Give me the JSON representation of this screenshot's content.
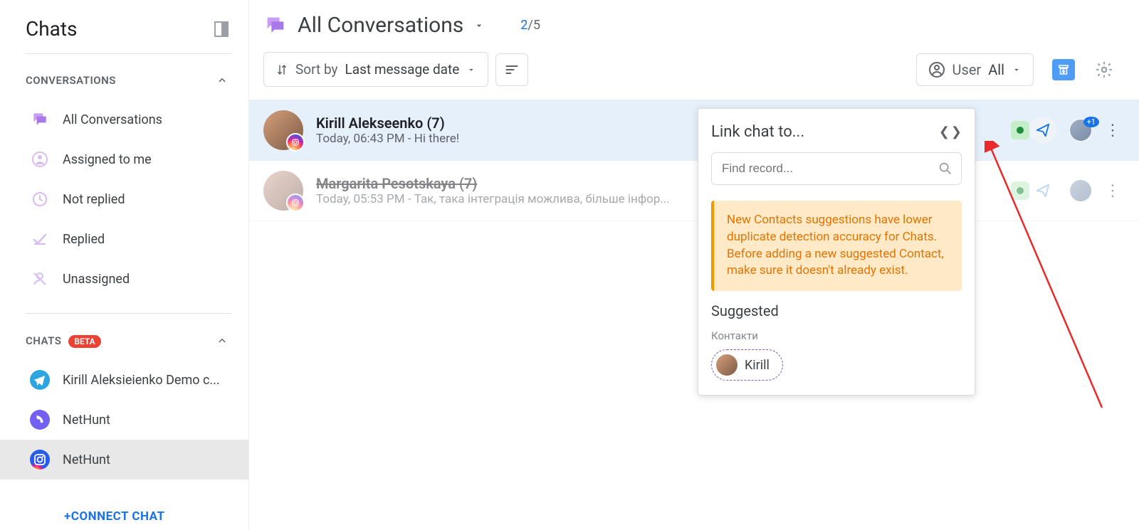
{
  "sidebar": {
    "title": "Chats",
    "sections": {
      "conversations": {
        "label": "CONVERSATIONS",
        "items": [
          {
            "label": "All Conversations"
          },
          {
            "label": "Assigned to me"
          },
          {
            "label": "Not replied"
          },
          {
            "label": "Replied"
          },
          {
            "label": "Unassigned"
          }
        ]
      },
      "chats": {
        "label": "CHATS",
        "badge": "BETA",
        "items": [
          {
            "label": "Kirill Aleksieienko Demo c..."
          },
          {
            "label": "NetHunt"
          },
          {
            "label": "NetHunt"
          }
        ]
      }
    },
    "connect": "+CONNECT CHAT"
  },
  "main": {
    "title": "All Conversations",
    "count_current": "2",
    "count_total": "/5",
    "sort_prefix": "Sort by",
    "sort_value": "Last message date",
    "user_filter_label": "User",
    "user_filter_value": "All"
  },
  "conversations": [
    {
      "name": "Kirill Alekseenko (7)",
      "sub": "Today, 06:43 PM - Hi there!",
      "plus_badge": "+1"
    },
    {
      "name": "Margarita Pesotskaya (7)",
      "sub": "Today, 05:53 PM - Так, така інтеграція можлива, більше інфор..."
    }
  ],
  "popup": {
    "title": "Link chat to...",
    "search_placeholder": "Find record...",
    "warning": "New Contacts suggestions have lower duplicate detection accuracy for Chats. Before adding a new suggested Contact, make sure it doesn't already exist.",
    "suggested_label": "Suggested",
    "category": "Контакти",
    "chip": "Kirill"
  }
}
